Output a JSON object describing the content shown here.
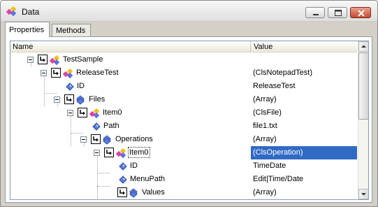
{
  "window": {
    "title": "Data"
  },
  "tabs": [
    {
      "label": "Properties",
      "active": true
    },
    {
      "label": "Methods",
      "active": false
    }
  ],
  "grid": {
    "columns": {
      "name": "Name",
      "value": "Value"
    },
    "rows": [
      {
        "name": "TestSample",
        "value": "",
        "icon": "class-object-icon",
        "level": 0
      },
      {
        "name": "ReleaseTest",
        "value": "(ClsNotepadTest)",
        "icon": "class-object-icon",
        "level": 1
      },
      {
        "name": "ID",
        "value": "ReleaseTest",
        "icon": "property-icon",
        "level": 2
      },
      {
        "name": "Files",
        "value": "(Array)",
        "icon": "array-icon",
        "level": 2
      },
      {
        "name": "Item0",
        "value": "(ClsFile)",
        "icon": "class-object-icon",
        "level": 3
      },
      {
        "name": "Path",
        "value": "file1.txt",
        "icon": "property-icon",
        "level": 4
      },
      {
        "name": "Operations",
        "value": "(Array)",
        "icon": "array-icon",
        "level": 4
      },
      {
        "name": "Item0",
        "value": "(ClsOperation)",
        "icon": "class-object-icon",
        "level": 5,
        "selected": true
      },
      {
        "name": "ID",
        "value": "TimeDate",
        "icon": "property-icon",
        "level": 6
      },
      {
        "name": "MenuPath",
        "value": "Edit|Time/Date",
        "icon": "property-icon",
        "level": 6
      },
      {
        "name": "Values",
        "value": "(Array)",
        "icon": "array-icon",
        "level": 6
      }
    ]
  },
  "colors": {
    "selection": "#316ac5",
    "close_button": "#c84b2e"
  }
}
